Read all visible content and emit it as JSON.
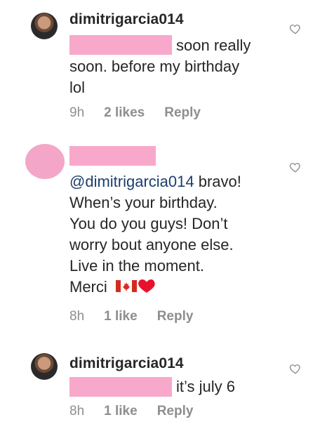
{
  "comments": [
    {
      "username": "dimitrigarcia014",
      "text_parts": [
        "soon really",
        "soon. before my birthday",
        "lol"
      ],
      "time": "9h",
      "likes": "2 likes",
      "reply": "Reply",
      "avatar": "user-photo"
    },
    {
      "username": "",
      "mention": "@dimitrigarcia014",
      "text_lines": [
        "bravo!",
        "When’s your birthday.",
        "You do you guys! Don’t",
        "worry bout anyone else.",
        "Live in the moment.",
        "Merci"
      ],
      "emoji": "canada-flag-heart",
      "time": "8h",
      "likes": "1 like",
      "reply": "Reply",
      "avatar": "redacted"
    },
    {
      "username": "dimitrigarcia014",
      "text": "it’s july 6",
      "time": "8h",
      "likes": "1 like",
      "reply": "Reply",
      "avatar": "user-photo"
    }
  ],
  "icons": {
    "like": "heart-outline-icon"
  },
  "colors": {
    "redaction": "#f7a8cb",
    "mention": "#1c3e6e",
    "meta": "#8e8e8e"
  }
}
